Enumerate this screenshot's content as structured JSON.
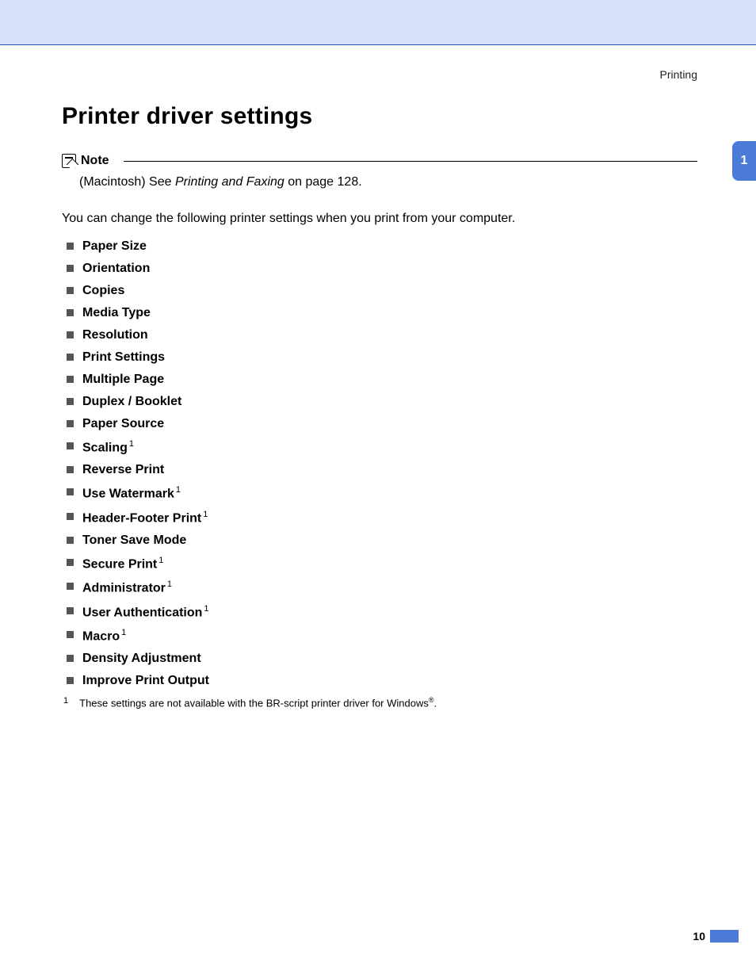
{
  "running_header": "Printing",
  "section_tab": "1",
  "title": "Printer driver settings",
  "note": {
    "label": "Note",
    "prefix": "(Macintosh) See ",
    "link_text": "Printing and Faxing",
    "suffix": " on page 128."
  },
  "intro": "You can change the following printer settings when you print from your computer.",
  "settings": [
    {
      "label": "Paper Size",
      "sup": ""
    },
    {
      "label": "Orientation",
      "sup": ""
    },
    {
      "label": "Copies",
      "sup": ""
    },
    {
      "label": "Media Type",
      "sup": ""
    },
    {
      "label": "Resolution",
      "sup": ""
    },
    {
      "label": "Print Settings",
      "sup": ""
    },
    {
      "label": "Multiple Page",
      "sup": ""
    },
    {
      "label": "Duplex / Booklet",
      "sup": ""
    },
    {
      "label": "Paper Source",
      "sup": ""
    },
    {
      "label": "Scaling",
      "sup": "1"
    },
    {
      "label": "Reverse Print",
      "sup": ""
    },
    {
      "label": "Use Watermark",
      "sup": "1"
    },
    {
      "label": "Header-Footer Print",
      "sup": "1"
    },
    {
      "label": "Toner Save Mode",
      "sup": ""
    },
    {
      "label": "Secure Print",
      "sup": "1"
    },
    {
      "label": "Administrator",
      "sup": "1"
    },
    {
      "label": "User Authentication",
      "sup": "1"
    },
    {
      "label": "Macro",
      "sup": "1"
    },
    {
      "label": "Density Adjustment",
      "sup": ""
    },
    {
      "label": "Improve Print Output",
      "sup": ""
    }
  ],
  "footnote": {
    "num": "1",
    "text_before": "These settings are not available with the BR-script printer driver for Windows",
    "reg": "®",
    "text_after": "."
  },
  "page_number": "10"
}
